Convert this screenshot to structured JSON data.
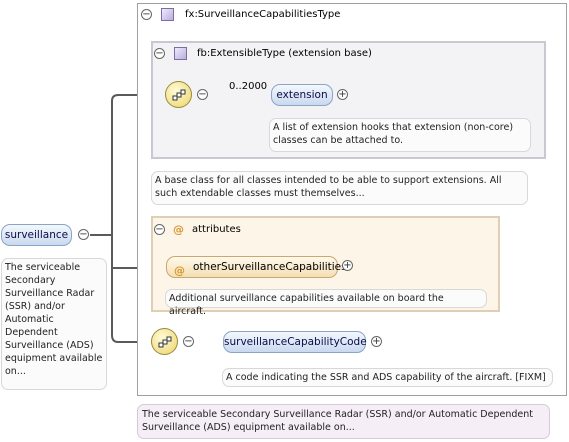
{
  "root": {
    "name": "surveillance",
    "doc": "The serviceable Secondary Surveillance Radar (SSR) and/or Automatic Dependent Surveillance (ADS) equipment available on..."
  },
  "type": {
    "name": "fx:SurveillanceCapabilitiesType",
    "doc": "The serviceable Secondary Surveillance Radar (SSR) and/or Automatic Dependent Surveillance (ADS) equipment available on..."
  },
  "base_type": {
    "name": "fb:ExtensibleType (extension base)",
    "doc": "A base class for all classes intended to be able to support extensions. All such extendable classes must themselves..."
  },
  "extension": {
    "name": "extension",
    "occurrence": "0..2000",
    "doc": "A list of extension hooks that extension (non-core) classes can be attached to."
  },
  "attributes": {
    "label": "attributes",
    "at_symbol": "@",
    "items": [
      {
        "name": "otherSurveillanceCapabilities",
        "doc": "Additional surveillance capabilities available on board the aircraft."
      }
    ]
  },
  "capability_code": {
    "name": "surveillanceCapabilityCode",
    "doc": "A code indicating the SSR and ADS capability of the aircraft. [FIXM]"
  },
  "glyphs": {
    "minus": "−",
    "plus": "+"
  },
  "colors": {
    "connector": "#5a5a5a",
    "element_fill": "#c9d9ee",
    "attribute_fill": "#f3dfb3",
    "type_icon": "#b9aedb",
    "doc_purple": "#f5eef7"
  },
  "icons": {
    "type": "complex-type-icon",
    "sequence": "sequence-compositor-icon",
    "attribute": "attribute-icon",
    "collapse": "collapse-minus-icon",
    "expand": "expand-plus-icon"
  }
}
